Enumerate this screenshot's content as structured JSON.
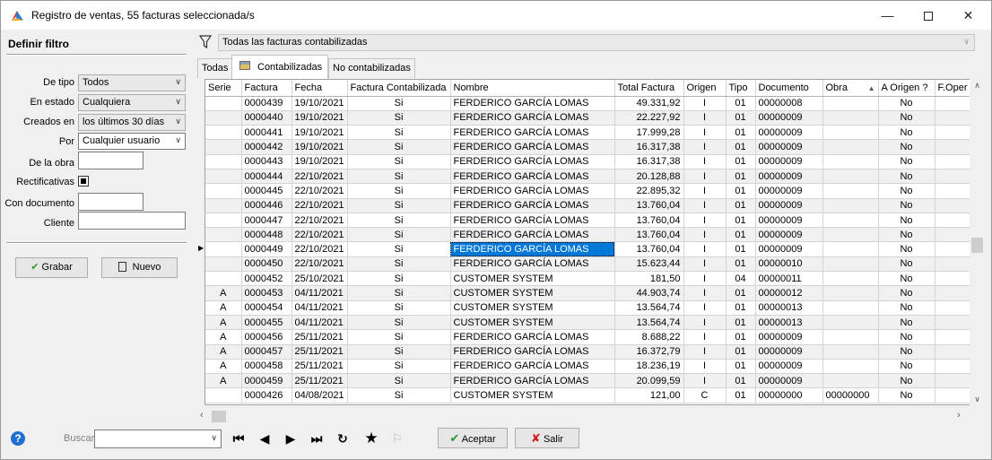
{
  "window": {
    "title": "Registro de ventas, 55  facturas seleccionada/s",
    "controls": [
      "minimize-icon",
      "maximize-icon",
      "close-icon"
    ]
  },
  "filter_panel": {
    "title": "Definir filtro",
    "tipo": {
      "label": "De tipo",
      "value": "Todos"
    },
    "estado": {
      "label": "En estado",
      "value": "Cualquiera"
    },
    "creados": {
      "label": "Creados en",
      "value": "los últimos 30 días"
    },
    "por": {
      "label": "Por",
      "value": "Cualquier usuario"
    },
    "obra": {
      "label": "De la obra",
      "value": ""
    },
    "rectificativas": {
      "label": "Rectificativas",
      "checked": true
    },
    "documento": {
      "label": "Con documento",
      "value": ""
    },
    "cliente": {
      "label": "Cliente",
      "value": ""
    },
    "grabar_label": "Grabar",
    "nuevo_label": "Nuevo"
  },
  "filter_bar": {
    "value": "Todas las facturas contabilizadas"
  },
  "tabs": [
    {
      "label": "Todas",
      "active": false
    },
    {
      "label": "Contabilizadas",
      "active": true
    },
    {
      "label": "No contabilizadas",
      "active": false
    }
  ],
  "grid": {
    "columns": [
      "Serie",
      "Factura",
      "Fecha",
      "Factura Contabilizada",
      "Nombre",
      "Total Factura",
      "Origen",
      "Tipo",
      "Documento",
      "Obra",
      "A Origen ?",
      "F.Oper"
    ],
    "sort_indicator": "▲",
    "current_row": 10,
    "selected_cell": "Nombre",
    "rows": [
      [
        "",
        "0000439",
        "19/10/2021",
        "Si",
        "FERDERICO GARCÍA LOMAS",
        "49.331,92",
        "I",
        "01",
        "00000008",
        "",
        "No",
        ""
      ],
      [
        "",
        "0000440",
        "19/10/2021",
        "Si",
        "FERDERICO GARCÍA LOMAS",
        "22.227,92",
        "I",
        "01",
        "00000009",
        "",
        "No",
        ""
      ],
      [
        "",
        "0000441",
        "19/10/2021",
        "Si",
        "FERDERICO GARCÍA LOMAS",
        "17.999,28",
        "I",
        "01",
        "00000009",
        "",
        "No",
        ""
      ],
      [
        "",
        "0000442",
        "19/10/2021",
        "Si",
        "FERDERICO GARCÍA LOMAS",
        "16.317,38",
        "I",
        "01",
        "00000009",
        "",
        "No",
        ""
      ],
      [
        "",
        "0000443",
        "19/10/2021",
        "Si",
        "FERDERICO GARCÍA LOMAS",
        "16.317,38",
        "I",
        "01",
        "00000009",
        "",
        "No",
        ""
      ],
      [
        "",
        "0000444",
        "22/10/2021",
        "Si",
        "FERDERICO GARCÍA LOMAS",
        "20.128,88",
        "I",
        "01",
        "00000009",
        "",
        "No",
        ""
      ],
      [
        "",
        "0000445",
        "22/10/2021",
        "Si",
        "FERDERICO GARCÍA LOMAS",
        "22.895,32",
        "I",
        "01",
        "00000009",
        "",
        "No",
        ""
      ],
      [
        "",
        "0000446",
        "22/10/2021",
        "Si",
        "FERDERICO GARCÍA LOMAS",
        "13.760,04",
        "I",
        "01",
        "00000009",
        "",
        "No",
        ""
      ],
      [
        "",
        "0000447",
        "22/10/2021",
        "Si",
        "FERDERICO GARCÍA LOMAS",
        "13.760,04",
        "I",
        "01",
        "00000009",
        "",
        "No",
        ""
      ],
      [
        "",
        "0000448",
        "22/10/2021",
        "Si",
        "FERDERICO GARCÍA LOMAS",
        "13.760,04",
        "I",
        "01",
        "00000009",
        "",
        "No",
        ""
      ],
      [
        "",
        "0000449",
        "22/10/2021",
        "Si",
        "FERDERICO GARCÍA LOMAS",
        "13.760,04",
        "I",
        "01",
        "00000009",
        "",
        "No",
        ""
      ],
      [
        "",
        "0000450",
        "22/10/2021",
        "Si",
        "FERDERICO GARCÍA LOMAS",
        "15.623,44",
        "I",
        "01",
        "00000010",
        "",
        "No",
        ""
      ],
      [
        "",
        "0000452",
        "25/10/2021",
        "Si",
        "CUSTOMER SYSTEM",
        "181,50",
        "I",
        "04",
        "00000011",
        "",
        "No",
        ""
      ],
      [
        "A",
        "0000453",
        "04/11/2021",
        "Si",
        "CUSTOMER SYSTEM",
        "44.903,74",
        "I",
        "01",
        "00000012",
        "",
        "No",
        ""
      ],
      [
        "A",
        "0000454",
        "04/11/2021",
        "Si",
        "CUSTOMER SYSTEM",
        "13.564,74",
        "I",
        "01",
        "00000013",
        "",
        "No",
        ""
      ],
      [
        "A",
        "0000455",
        "04/11/2021",
        "Si",
        "CUSTOMER SYSTEM",
        "13.564,74",
        "I",
        "01",
        "00000013",
        "",
        "No",
        ""
      ],
      [
        "A",
        "0000456",
        "25/11/2021",
        "Si",
        "FERDERICO GARCÍA LOMAS",
        "8.688,22",
        "I",
        "01",
        "00000009",
        "",
        "No",
        ""
      ],
      [
        "A",
        "0000457",
        "25/11/2021",
        "Si",
        "FERDERICO GARCÍA LOMAS",
        "16.372,79",
        "I",
        "01",
        "00000009",
        "",
        "No",
        ""
      ],
      [
        "A",
        "0000458",
        "25/11/2021",
        "Si",
        "FERDERICO GARCÍA LOMAS",
        "18.236,19",
        "I",
        "01",
        "00000009",
        "",
        "No",
        ""
      ],
      [
        "A",
        "0000459",
        "25/11/2021",
        "Si",
        "FERDERICO GARCÍA LOMAS",
        "20.099,59",
        "I",
        "01",
        "00000009",
        "",
        "No",
        ""
      ],
      [
        "",
        "0000426",
        "04/08/2021",
        "Si",
        "CUSTOMER SYSTEM",
        "121,00",
        "C",
        "01",
        "00000000",
        "00000000",
        "No",
        ""
      ]
    ]
  },
  "bottom": {
    "search_label": "Buscar:",
    "search_value": "",
    "nav": [
      "first-icon",
      "prev-icon",
      "next-icon",
      "last-icon",
      "refresh-icon",
      "star-icon",
      "bookmark-icon"
    ],
    "accept_label": "Aceptar",
    "exit_label": "Salir"
  },
  "colors": {
    "selection": "#0078d7",
    "accept_check": "#2e9e2e",
    "exit_x": "#d11a1a"
  }
}
